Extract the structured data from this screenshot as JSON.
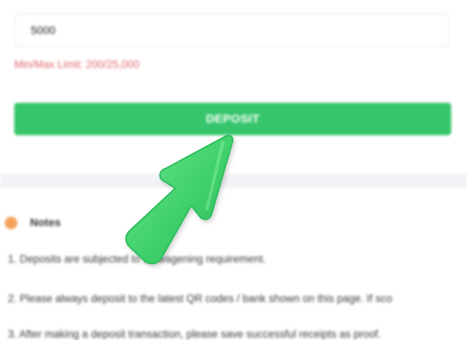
{
  "form": {
    "amount_value": "5000",
    "limit_text": "Min/Max Limit: 200/25,000",
    "deposit_label": "DEPOSIT"
  },
  "notes": {
    "title": "Notes",
    "items": [
      "1. Deposits are subjected to 1x wagening requirement.",
      "2. Please always deposit to the latest QR codes / bank shown on this page. If sco",
      "3. After making a deposit transaction, please save successful receipts as proof."
    ]
  },
  "colors": {
    "primary_green": "#36c56b",
    "limit_red": "#e0656a",
    "notes_dot": "#f4a35c",
    "divider": "#f1f3f7"
  },
  "icons": {
    "pointer": "arrow-pointer-icon",
    "notes": "dot-icon"
  }
}
